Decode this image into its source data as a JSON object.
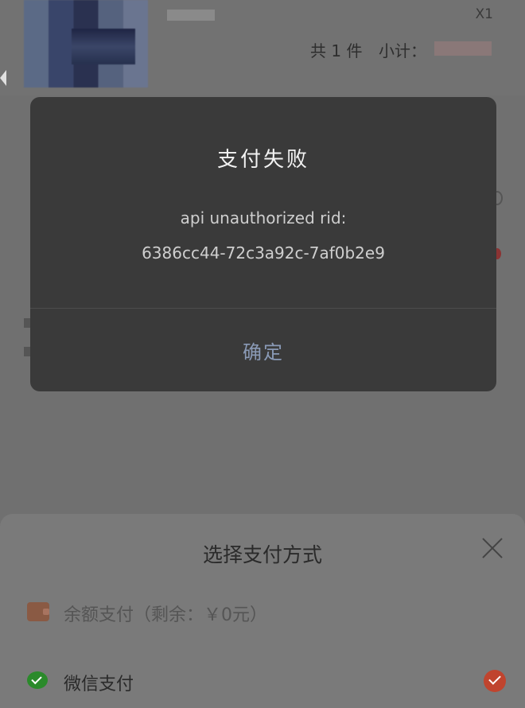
{
  "order": {
    "quantity": "X1",
    "count_text": "共 1 件",
    "subtotal_label": "小计："
  },
  "dialog": {
    "title": "支付失败",
    "message_line1": "api unauthorized rid:",
    "message_line2": "6386cc44-72c3a92c-7af0b2e9",
    "confirm_label": "确定"
  },
  "payment_sheet": {
    "title": "选择支付方式",
    "options": [
      {
        "label": "余额支付（剩余：￥0元）",
        "icon": "wallet-icon",
        "selected": false
      },
      {
        "label": "微信支付",
        "icon": "wechat-pay-icon",
        "selected": true
      }
    ]
  },
  "colors": {
    "dialog_bg": "#3a3a3a",
    "confirm_text": "#8a9ab6",
    "selected_check": "#c0442e",
    "wechat_green": "#2b8a2b"
  }
}
